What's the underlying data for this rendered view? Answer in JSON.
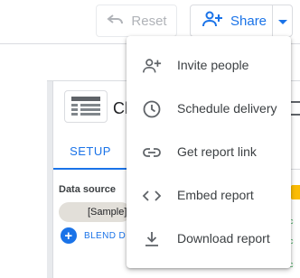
{
  "header": {
    "reset_label": "Reset",
    "share_label": "Share"
  },
  "panel": {
    "chart_title": "Ch",
    "tab_setup": "SETUP",
    "data_source_label": "Data source",
    "data_source_chip": "[Sample]",
    "blend_label": "BLEND D"
  },
  "share_menu": {
    "items": [
      {
        "label": "Invite people",
        "icon": "person-add-icon"
      },
      {
        "label": "Schedule delivery",
        "icon": "clock-icon"
      },
      {
        "label": "Get report link",
        "icon": "link-icon"
      },
      {
        "label": "Embed report",
        "icon": "code-icon"
      },
      {
        "label": "Download report",
        "icon": "download-icon"
      }
    ]
  },
  "colors": {
    "accent": "#1a73e8",
    "menu_text": "#3c4043",
    "icon": "#5f6368"
  }
}
